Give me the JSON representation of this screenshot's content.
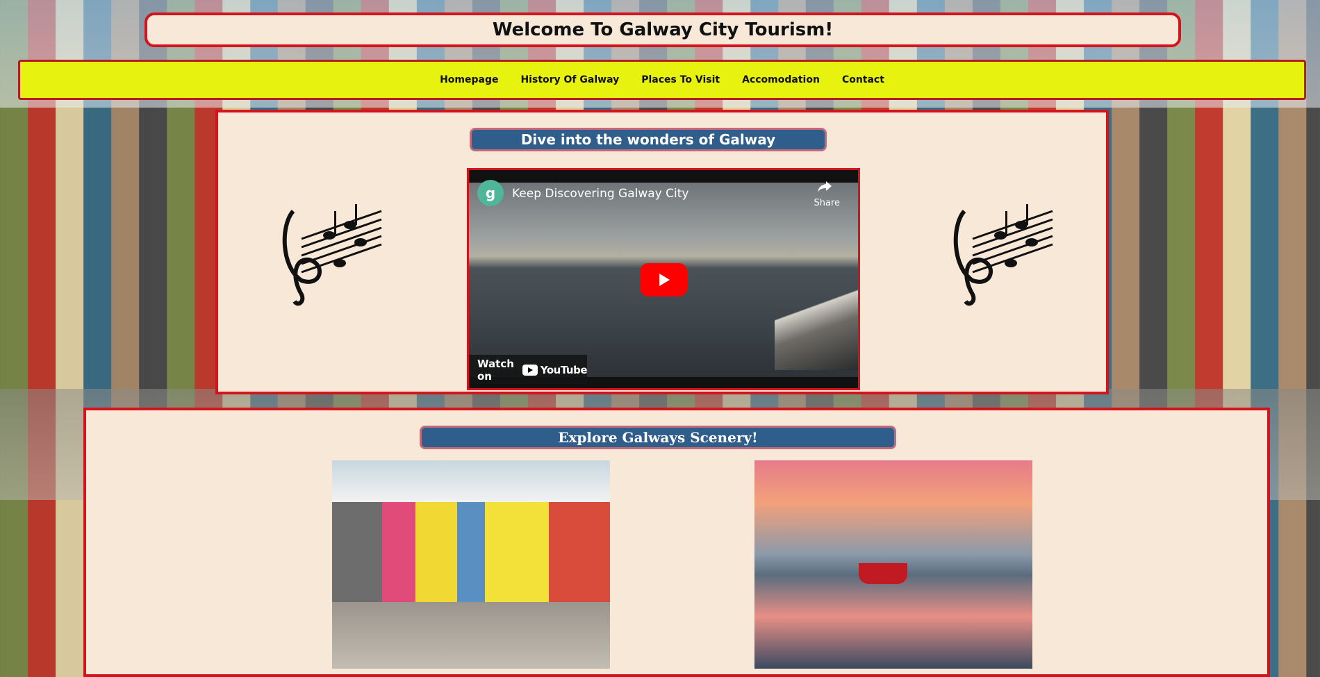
{
  "page": {
    "title": "Welcome To Galway City Tourism!"
  },
  "nav": {
    "items": [
      {
        "label": "Homepage"
      },
      {
        "label": "History Of Galway"
      },
      {
        "label": "Places To Visit"
      },
      {
        "label": "Accomodation"
      },
      {
        "label": "Contact"
      }
    ]
  },
  "video_section": {
    "heading": "Dive into the wonders of Galway",
    "video": {
      "title": "Keep Discovering Galway City",
      "share_label": "Share",
      "watch_on_label": "Watch on",
      "platform": "YouTube"
    }
  },
  "scenery_section": {
    "heading": "Explore Galways Scenery!"
  },
  "colors": {
    "panel_bg": "#f7e8d7",
    "border_red": "#d4141c",
    "nav_yellow": "#e8f20f",
    "pill_blue": "#2f5e8c",
    "youtube_red": "#ff0000"
  },
  "icons": [
    "music-notes-icon",
    "youtube-channel-icon",
    "share-icon",
    "play-icon",
    "youtube-logo-icon"
  ]
}
